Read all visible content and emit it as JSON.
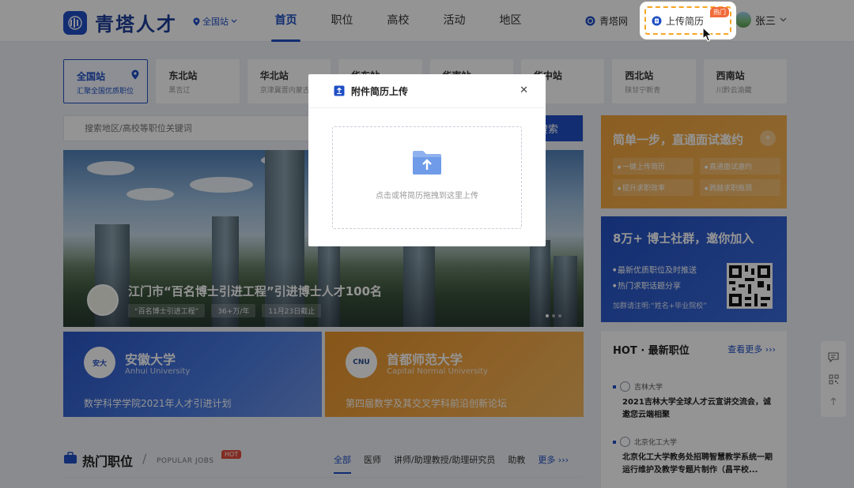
{
  "header": {
    "logo_text": "青塔人才",
    "station_select": "全国站",
    "nav": [
      "首页",
      "职位",
      "高校",
      "活动",
      "地区"
    ],
    "site_link": "青塔网",
    "upload_label": "上传简历",
    "upload_hot": "热门",
    "user_name": "张三"
  },
  "stations": [
    {
      "name": "全国站",
      "sub": "汇聚全国优质职位"
    },
    {
      "name": "东北站",
      "sub": "黑吉辽"
    },
    {
      "name": "华北站",
      "sub": "京津冀晋内蒙古"
    },
    {
      "name": "华东站",
      "sub": ""
    },
    {
      "name": "华南站",
      "sub": ""
    },
    {
      "name": "华中站",
      "sub": ""
    },
    {
      "name": "西北站",
      "sub": "陕甘宁新青"
    },
    {
      "name": "西南站",
      "sub": "川黔云渝藏"
    }
  ],
  "search": {
    "placeholder": "搜索地区/高校等职位关键词",
    "button": "搜索"
  },
  "banner": {
    "badge": "",
    "title": "江门市“百名博士引进工程”引进博士人才100名",
    "tags": [
      "“百名博士引进工程”",
      "36+万/年",
      "11月23日截止"
    ]
  },
  "uni_cards": [
    {
      "emblem": "安大",
      "name": "安徽大学",
      "en": "Anhui University",
      "desc": "数学科学学院2021年人才引进计划"
    },
    {
      "emblem": "CNU",
      "name": "首都师范大学",
      "en": "Capital Normal University",
      "desc": "第四届数学及其交叉学科前沿创新论坛"
    }
  ],
  "hot_jobs": {
    "title": "热门职位",
    "en": "POPULAR JOBS",
    "hot": "HOT",
    "tabs": [
      "全部",
      "医师",
      "讲师/助理教授/助理研究员",
      "助教"
    ],
    "more": "更多 ›››"
  },
  "side_orange": {
    "title": "简单一步，直通面试邀约",
    "items": [
      "一键上传简历",
      "直通面试邀约",
      "提升求职效率",
      "跨越求职瓶颈"
    ]
  },
  "side_blue": {
    "title": "8万+ 博士社群，邀你加入",
    "items": [
      "最新优质职位及时推送",
      "热门求职话题分享"
    ],
    "note": "加群请注明:“姓名+毕业院校”"
  },
  "latest": {
    "title": "HOT · 最新职位",
    "more": "查看更多 ›››",
    "items": [
      {
        "school": "吉林大学",
        "text": "2021吉林大学全球人才云宣讲交流会，诚邀您云端相聚"
      },
      {
        "school": "北京化工大学",
        "text": "北京化工大学教务处招聘智慧教学系统一期运行维护及教学专题片制作（昌平校..."
      }
    ]
  },
  "modal": {
    "title": "附件简历上传",
    "drop_text": "点击或将简历拖拽到这里上传"
  },
  "colors": {
    "primary": "#1f4fc4",
    "accent": "#f0a23b",
    "hot": "#e24a3b"
  }
}
